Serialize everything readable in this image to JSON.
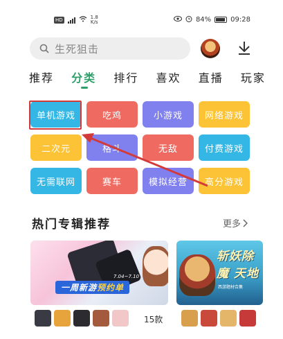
{
  "status_bar": {
    "hd_badge": "HD",
    "network_type": "4G",
    "speed_value": "1.8",
    "speed_unit": "K/s",
    "battery": "84%",
    "time": "09:28",
    "icons": [
      "hd-icon",
      "signal-icon",
      "wifi-icon",
      "eye-icon",
      "alarm-icon",
      "battery-icon"
    ]
  },
  "search": {
    "placeholder": "生死狙击",
    "icon": "search-icon"
  },
  "header": {
    "avatar_icon": "avatar-icon",
    "download_icon": "download-icon"
  },
  "tabs": [
    {
      "label": "推荐",
      "active": false
    },
    {
      "label": "分类",
      "active": true
    },
    {
      "label": "排行",
      "active": false
    },
    {
      "label": "喜欢",
      "active": false
    },
    {
      "label": "直播",
      "active": false
    },
    {
      "label": "玩家",
      "active": false
    }
  ],
  "categories": [
    {
      "label": "单机游戏",
      "color": "#35b7e6",
      "highlighted": true
    },
    {
      "label": "吃鸡",
      "color": "#ef6b61"
    },
    {
      "label": "小游戏",
      "color": "#8080ee"
    },
    {
      "label": "网络游戏",
      "color": "#fbc335"
    },
    {
      "label": "二次元",
      "color": "#fbc335"
    },
    {
      "label": "格斗",
      "color": "#8080ee"
    },
    {
      "label": "无敌",
      "color": "#ef6b61"
    },
    {
      "label": "付费游戏",
      "color": "#35b7e6"
    },
    {
      "label": "无需联网",
      "color": "#35b7e6"
    },
    {
      "label": "赛车",
      "color": "#ef6b61"
    },
    {
      "label": "模拟经营",
      "color": "#8080ee"
    },
    {
      "label": "高分游戏",
      "color": "#fbc335"
    }
  ],
  "annotation": {
    "highlight_color": "#d33a3a"
  },
  "section": {
    "title": "热门专辑推荐",
    "more_label": "更多"
  },
  "cards": [
    {
      "banner_prefix": "一周新游",
      "banner_highlight": "预约单",
      "date": "7.04~7.10",
      "count": "15款"
    },
    {
      "title": "斩妖除魔 天地",
      "subtitle": "西游题材合集"
    }
  ],
  "accent_color": "#2e9e6a"
}
